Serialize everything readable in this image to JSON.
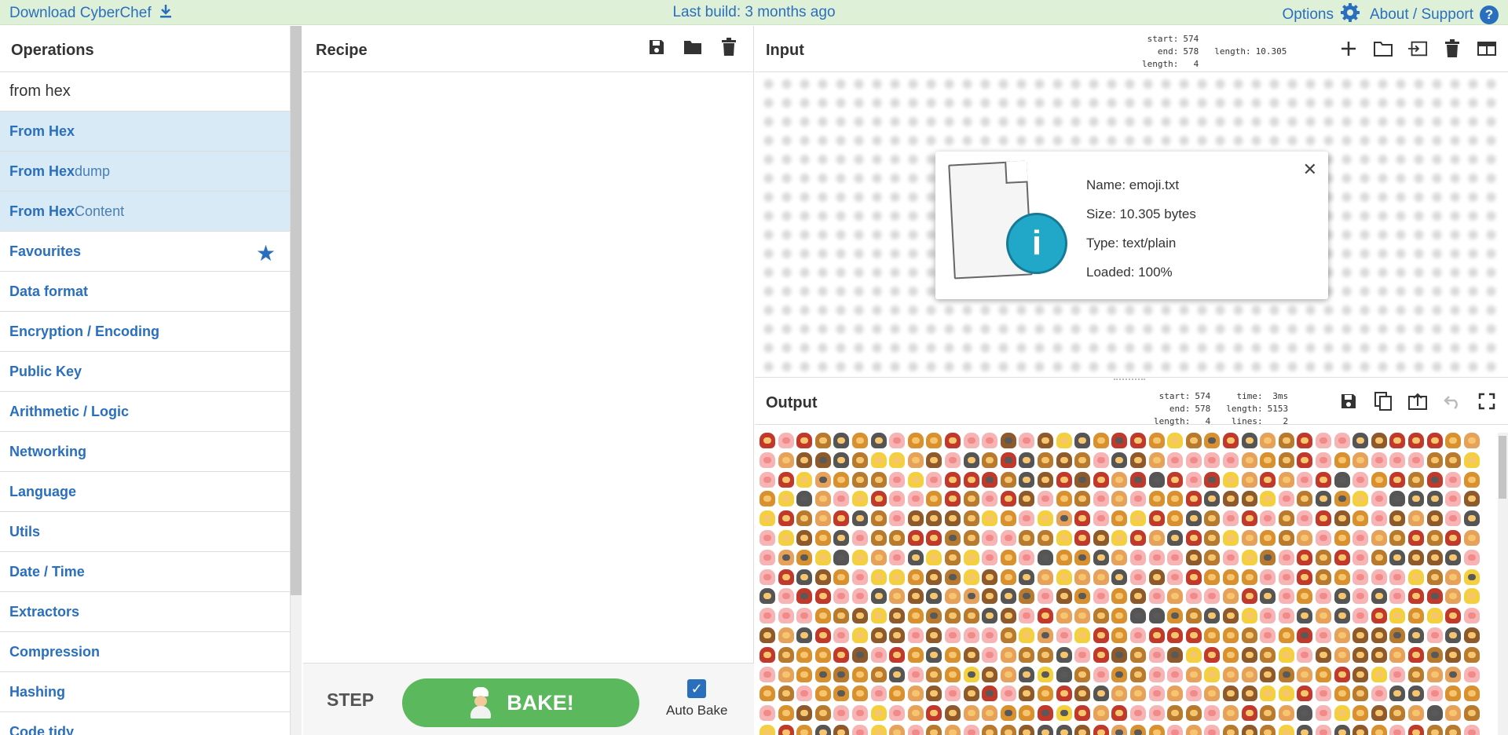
{
  "banner": {
    "download_label": "Download CyberChef",
    "last_build": "Last build: 3 months ago",
    "options_label": "Options",
    "about_label": "About / Support"
  },
  "operations": {
    "title": "Operations",
    "search_value": "from hex",
    "results": [
      {
        "match": "From Hex",
        "rest": ""
      },
      {
        "match": "From Hex",
        "rest": "dump"
      },
      {
        "match": "From Hex",
        "rest": " Content"
      }
    ],
    "categories": [
      "Favourites",
      "Data format",
      "Encryption / Encoding",
      "Public Key",
      "Arithmetic / Logic",
      "Networking",
      "Language",
      "Utils",
      "Date / Time",
      "Extractors",
      "Compression",
      "Hashing",
      "Code tidy"
    ]
  },
  "recipe": {
    "title": "Recipe",
    "step_label": "STEP",
    "bake_label": "BAKE!",
    "autobake_label": "Auto Bake",
    "autobake_checked": true
  },
  "input": {
    "title": "Input",
    "stats": {
      "start": "574",
      "end": "578",
      "length_sel": "4",
      "length": "10.305"
    },
    "file": {
      "name": "Name: emoji.txt",
      "size": "Size: 10.305 bytes",
      "type": "Type: text/plain",
      "loaded": "Loaded: 100%"
    }
  },
  "output": {
    "title": "Output",
    "stats": {
      "start": "574",
      "end": "578",
      "length_sel": "4",
      "time": "3ms",
      "length": "5153",
      "lines": "2"
    }
  },
  "colors": {
    "accent": "#2a6fbd",
    "banner_bg": "#dff0d8",
    "bake_green": "#5cb85c",
    "highlight": "#d8eaf5"
  }
}
